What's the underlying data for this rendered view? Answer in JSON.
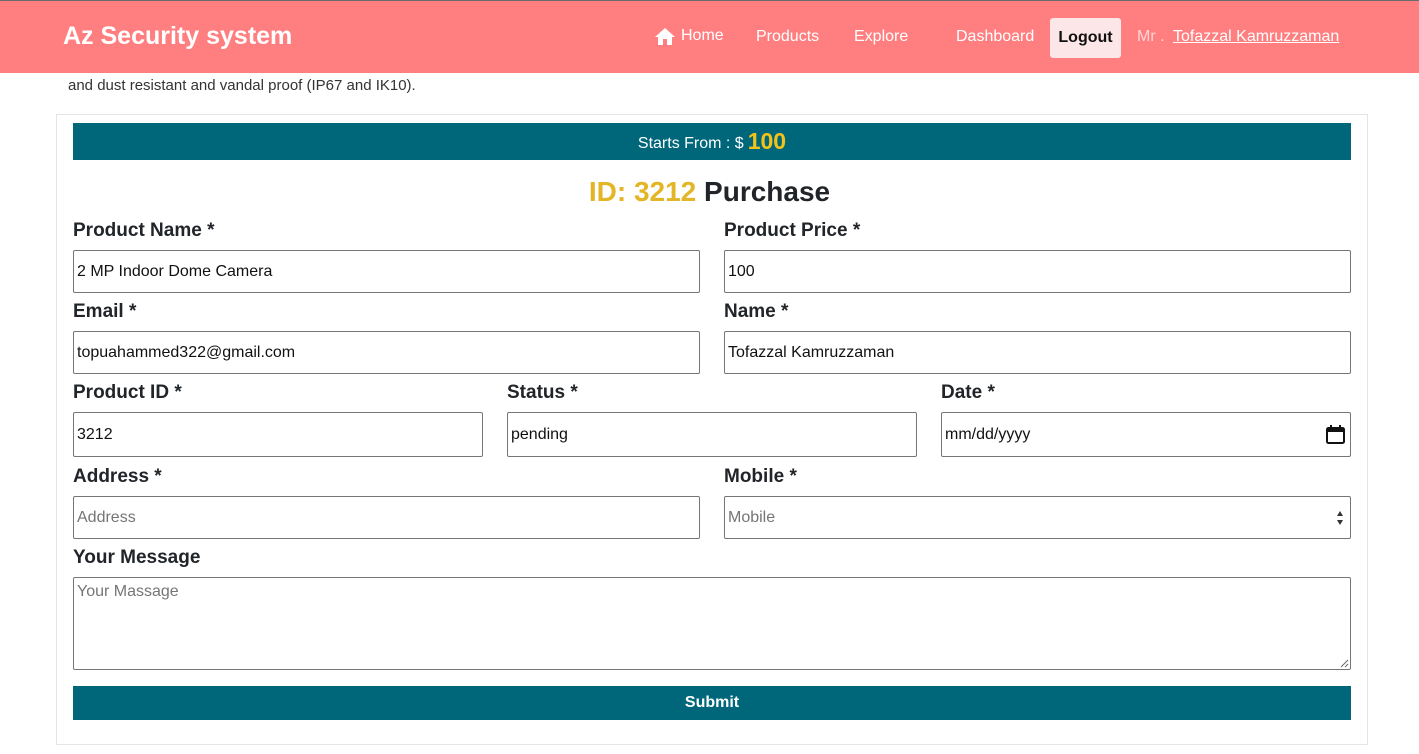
{
  "nav": {
    "brand": "Az Security system",
    "links": [
      "Home",
      "Products",
      "Explore",
      "Dashboard"
    ],
    "logout": "Logout",
    "user_prefix": "Mr .",
    "user_name": "Tofazzal Kamruzzaman",
    "background_color": "#ff7f80"
  },
  "description_tail": "and dust resistant and vandal proof (IP67 and IK10).",
  "price_bar": {
    "label": "Starts From : $",
    "amount": "100",
    "color": "#00677a"
  },
  "purchase_title": {
    "id_part": "ID: 3212",
    "word": "Purchase"
  },
  "form": {
    "product_name": {
      "label": "Product Name *",
      "value": "2 MP  Indoor Dome Camera"
    },
    "product_price": {
      "label": "Product Price *",
      "value": "100"
    },
    "email": {
      "label": "Email *",
      "value": "topuahammed322@gmail.com"
    },
    "name": {
      "label": "Name *",
      "value": "Tofazzal Kamruzzaman"
    },
    "product_id": {
      "label": "Product ID *",
      "value": "3212"
    },
    "status": {
      "label": "Status *",
      "value": "pending"
    },
    "date": {
      "label": "Date *",
      "placeholder": "mm/dd/yyyy"
    },
    "address": {
      "label": "Address *",
      "placeholder": "Address"
    },
    "mobile": {
      "label": "Mobile *",
      "placeholder": "Mobile"
    },
    "message": {
      "label": "Your Message",
      "placeholder": "Your Massage"
    },
    "submit": "Submit"
  }
}
